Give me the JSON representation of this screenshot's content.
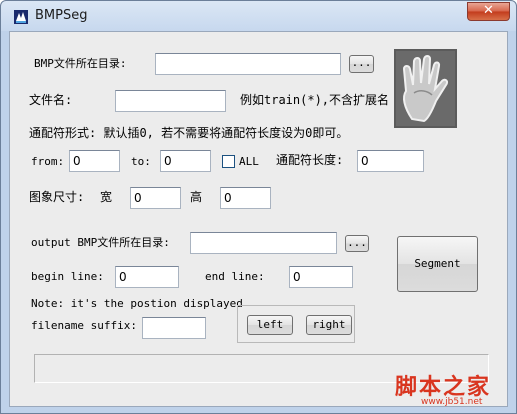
{
  "window": {
    "title": "BMPSeg",
    "close_glyph": "✕"
  },
  "form": {
    "bmp_dir_label": "BMP文件所在目录:",
    "bmp_dir_value": "",
    "browse_label": "...",
    "filename_label": "文件名:",
    "filename_value": "",
    "filename_hint": "例如train(*),不含扩展名",
    "wildcard_note": "通配符形式: 默认插0, 若不需要将通配符长度设为0即可。",
    "from_label": "from:",
    "from_value": "0",
    "to_label": "to:",
    "to_value": "0",
    "all_label": "ALL",
    "all_checked": false,
    "wildcard_len_label": "通配符长度:",
    "wildcard_len_value": "0",
    "image_size_label": "图象尺寸:",
    "width_label": "宽",
    "width_value": "0",
    "height_label": "高",
    "height_value": "0",
    "output_dir_label": "output BMP文件所在目录:",
    "output_dir_value": "",
    "output_browse_label": "...",
    "segment_label": "Segment",
    "begin_line_label": "begin line:",
    "begin_line_value": "0",
    "end_line_label": "end line:",
    "end_line_value": "0",
    "note_label": "Note: it's the postion displayed",
    "suffix_label": "filename suffix:",
    "suffix_value": "",
    "left_label": "left",
    "right_label": "right"
  },
  "watermark": {
    "main": "脚本之家",
    "sub": "www.jb51.net"
  }
}
